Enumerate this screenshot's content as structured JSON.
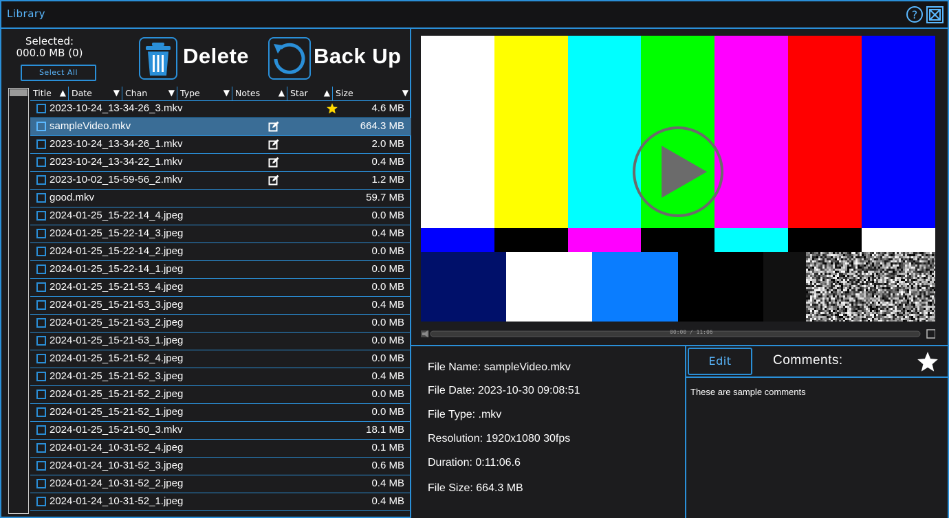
{
  "window": {
    "title": "Library",
    "help_icon": "?",
    "close_icon": "close-box-icon"
  },
  "toolbar": {
    "selected_label": "Selected:",
    "selected_value": "000.0 MB (0)",
    "select_all_label": "Select All",
    "delete_label": "Delete",
    "backup_label": "Back Up"
  },
  "table": {
    "columns": [
      {
        "label": "Title",
        "sort": "asc"
      },
      {
        "label": "Date",
        "sort": "desc"
      },
      {
        "label": "Chan",
        "sort": "desc"
      },
      {
        "label": "Type",
        "sort": "desc"
      },
      {
        "label": "Notes",
        "sort": "asc"
      },
      {
        "label": "Star",
        "sort": "asc"
      },
      {
        "label": "Size",
        "sort": "desc"
      }
    ],
    "rows": [
      {
        "name": "2023-10-24_13-34-26_3.mkv",
        "size": "4.6 MB",
        "note": false,
        "star": true,
        "selected": false
      },
      {
        "name": "sampleVideo.mkv",
        "size": "664.3 MB",
        "note": true,
        "star": false,
        "selected": true
      },
      {
        "name": "2023-10-24_13-34-26_1.mkv",
        "size": "2.0 MB",
        "note": true,
        "star": false,
        "selected": false
      },
      {
        "name": "2023-10-24_13-34-22_1.mkv",
        "size": "0.4 MB",
        "note": true,
        "star": false,
        "selected": false
      },
      {
        "name": "2023-10-02_15-59-56_2.mkv",
        "size": "1.2 MB",
        "note": true,
        "star": false,
        "selected": false
      },
      {
        "name": "good.mkv",
        "size": "59.7 MB",
        "note": false,
        "star": false,
        "selected": false
      },
      {
        "name": "2024-01-25_15-22-14_4.jpeg",
        "size": "0.0 MB",
        "note": false,
        "star": false,
        "selected": false
      },
      {
        "name": "2024-01-25_15-22-14_3.jpeg",
        "size": "0.4 MB",
        "note": false,
        "star": false,
        "selected": false
      },
      {
        "name": "2024-01-25_15-22-14_2.jpeg",
        "size": "0.0 MB",
        "note": false,
        "star": false,
        "selected": false
      },
      {
        "name": "2024-01-25_15-22-14_1.jpeg",
        "size": "0.0 MB",
        "note": false,
        "star": false,
        "selected": false
      },
      {
        "name": "2024-01-25_15-21-53_4.jpeg",
        "size": "0.0 MB",
        "note": false,
        "star": false,
        "selected": false
      },
      {
        "name": "2024-01-25_15-21-53_3.jpeg",
        "size": "0.4 MB",
        "note": false,
        "star": false,
        "selected": false
      },
      {
        "name": "2024-01-25_15-21-53_2.jpeg",
        "size": "0.0 MB",
        "note": false,
        "star": false,
        "selected": false
      },
      {
        "name": "2024-01-25_15-21-53_1.jpeg",
        "size": "0.0 MB",
        "note": false,
        "star": false,
        "selected": false
      },
      {
        "name": "2024-01-25_15-21-52_4.jpeg",
        "size": "0.0 MB",
        "note": false,
        "star": false,
        "selected": false
      },
      {
        "name": "2024-01-25_15-21-52_3.jpeg",
        "size": "0.4 MB",
        "note": false,
        "star": false,
        "selected": false
      },
      {
        "name": "2024-01-25_15-21-52_2.jpeg",
        "size": "0.0 MB",
        "note": false,
        "star": false,
        "selected": false
      },
      {
        "name": "2024-01-25_15-21-52_1.jpeg",
        "size": "0.0 MB",
        "note": false,
        "star": false,
        "selected": false
      },
      {
        "name": "2024-01-25_15-21-50_3.mkv",
        "size": "18.1 MB",
        "note": false,
        "star": false,
        "selected": false
      },
      {
        "name": "2024-01-24_10-31-52_4.jpeg",
        "size": "0.1 MB",
        "note": false,
        "star": false,
        "selected": false
      },
      {
        "name": "2024-01-24_10-31-52_3.jpeg",
        "size": "0.6 MB",
        "note": false,
        "star": false,
        "selected": false
      },
      {
        "name": "2024-01-24_10-31-52_2.jpeg",
        "size": "0.4 MB",
        "note": false,
        "star": false,
        "selected": false
      },
      {
        "name": "2024-01-24_10-31-52_1.jpeg",
        "size": "0.4 MB",
        "note": false,
        "star": false,
        "selected": false
      }
    ]
  },
  "player": {
    "time_display": "00:00 / 11:06",
    "progress": 0.0,
    "play_icon": "play-icon",
    "mute_icon": "speaker-icon",
    "fullscreen_icon": "fullscreen-icon"
  },
  "file_info": {
    "file_name": "File Name:  sampleVideo.mkv",
    "file_date": "File Date:  2023-10-30 09:08:51",
    "file_type": "File Type:  .mkv",
    "resolution": "Resolution:  1920x1080 30fps",
    "duration": "Duration:  0:11:06.6",
    "file_size": "File Size:  664.3 MB"
  },
  "comments": {
    "edit_label": "Edit",
    "title": "Comments:",
    "text": "These are sample comments",
    "starred": false
  },
  "colors": {
    "accent": "#2a8fd8",
    "accent_light": "#5ab8ff",
    "background": "#1c1c1e",
    "selected_row": "#3a6d96",
    "star": "#ffd800"
  }
}
